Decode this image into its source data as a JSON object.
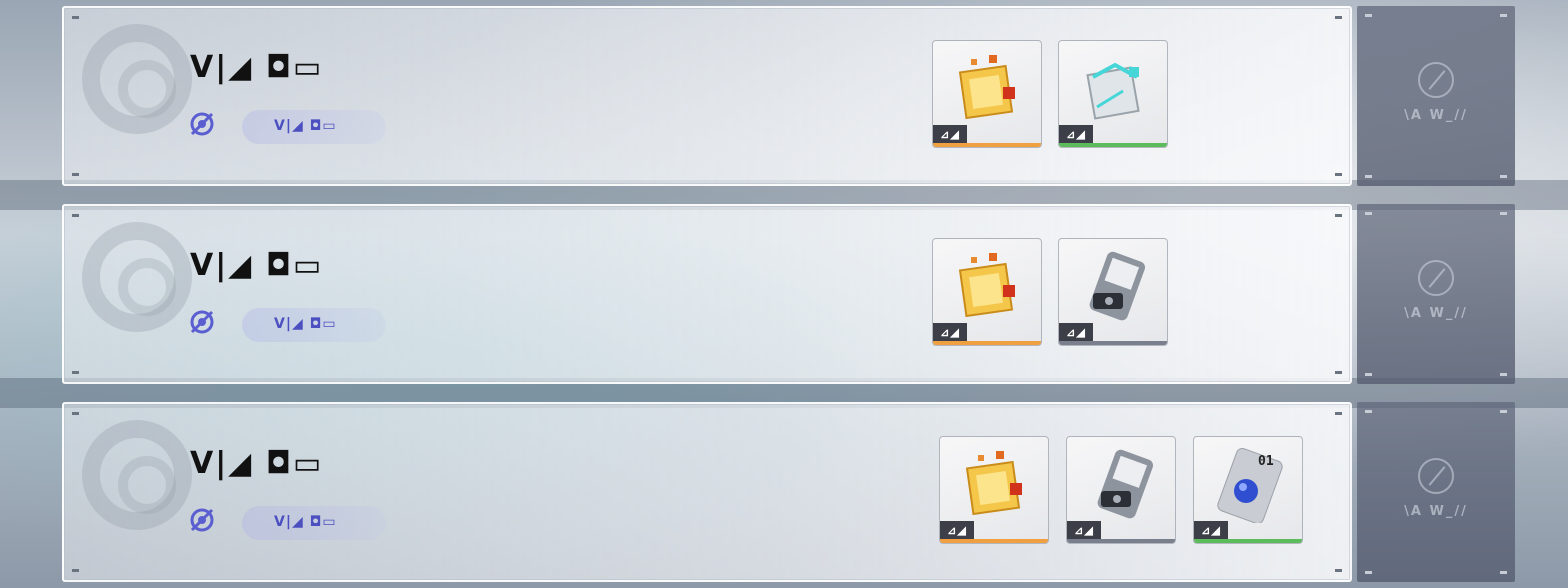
{
  "rows": [
    {
      "title": "V|◢ ◘▭",
      "sub_label": "V|◢ ◘▭",
      "rarity_label": "⊿◢",
      "items": [
        {
          "icon": "golden-cube-icon",
          "bar_color": "#f0a040"
        },
        {
          "icon": "teal-cube-icon",
          "bar_color": "#5cbc5c"
        }
      ],
      "side_label": "\\A W_//"
    },
    {
      "title": "V|◢ ◘▭",
      "sub_label": "V|◢ ◘▭",
      "rarity_label": "⊿◢",
      "items": [
        {
          "icon": "golden-cube-icon",
          "bar_color": "#f0a040"
        },
        {
          "icon": "device-card-icon",
          "bar_color": "#7a7f8e"
        }
      ],
      "side_label": "\\A W_//"
    },
    {
      "title": "V|◢ ◘▭",
      "sub_label": "V|◢ ◘▭",
      "rarity_label": "⊿◢",
      "items": [
        {
          "icon": "golden-cube-icon",
          "bar_color": "#f0a040"
        },
        {
          "icon": "device-card-icon",
          "bar_color": "#7a7f8e"
        },
        {
          "icon": "blue-button-chip-icon",
          "bar_color": "#5cbc5c",
          "chip_number": "01"
        }
      ],
      "side_label": "\\A W_//"
    }
  ],
  "colors": {
    "accent": "#4b4fc0",
    "orange": "#f0a040",
    "green": "#5cbc5c",
    "grey": "#7a7f8e"
  }
}
